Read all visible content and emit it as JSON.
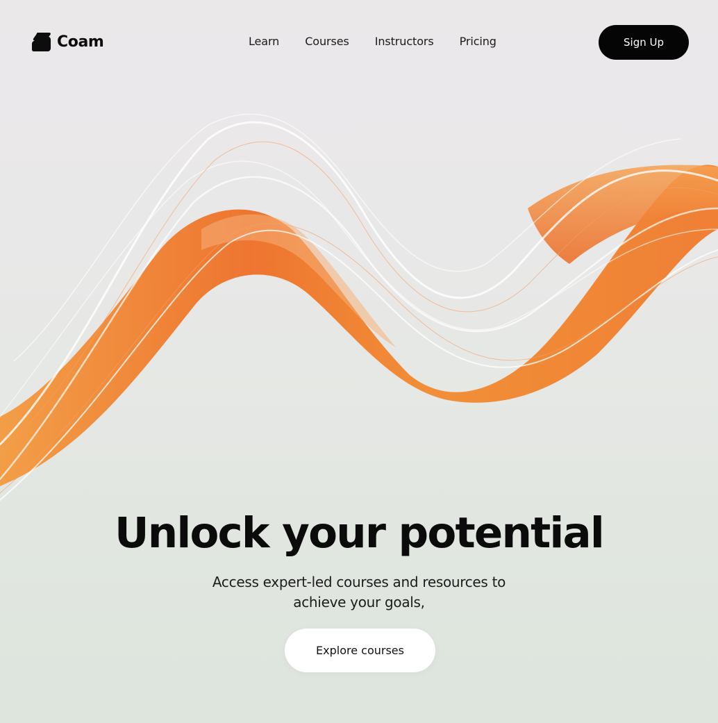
{
  "brand": {
    "name": "Coam",
    "logo_icon": "coam-logo-icon"
  },
  "nav": {
    "items": [
      {
        "label": "Learn"
      },
      {
        "label": "Courses"
      },
      {
        "label": "Instructors"
      },
      {
        "label": "Pricing"
      }
    ],
    "signup_label": "Sign Up"
  },
  "hero": {
    "title": "Unlock your potential",
    "subtitle_line1": "Access expert-led courses and resources to",
    "subtitle_line2": "achieve your goals,",
    "cta_label": "Explore courses",
    "artwork": "orange-ribbon-wave"
  },
  "colors": {
    "accent": "#f07a2a",
    "button_dark": "#050505",
    "background": "#e6e8e5"
  }
}
